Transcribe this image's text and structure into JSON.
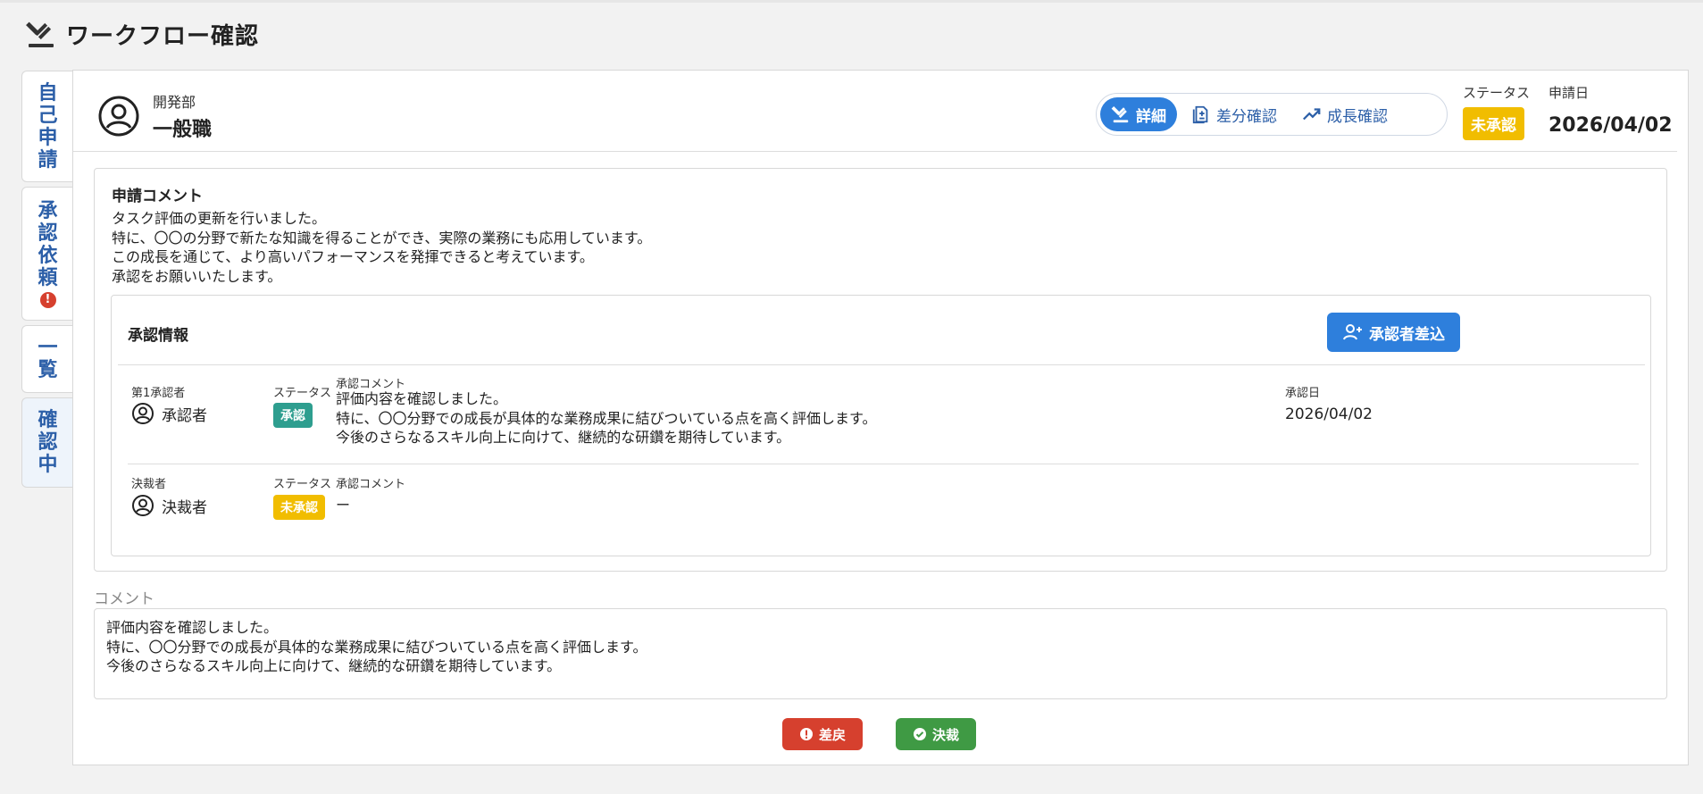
{
  "app": {
    "title": "ワークフロー確認"
  },
  "sidebar": {
    "tabs": [
      {
        "label": "自己申請",
        "chars": [
          "自",
          "己",
          "申",
          "請"
        ]
      },
      {
        "label": "承認依頼",
        "chars": [
          "承",
          "認",
          "依",
          "頼"
        ],
        "alert": "!"
      },
      {
        "label": "一覧",
        "chars": [
          "一",
          "覧"
        ]
      },
      {
        "label": "確認中",
        "chars": [
          "確",
          "認",
          "中"
        ],
        "active": true
      }
    ]
  },
  "profile": {
    "department": "開発部",
    "role": "一般職"
  },
  "view_tabs": [
    {
      "label": "詳細",
      "icon": "gavel-icon",
      "active": true
    },
    {
      "label": "差分確認",
      "icon": "document-diff-icon"
    },
    {
      "label": "成長確認",
      "icon": "trending-up-icon"
    }
  ],
  "status": {
    "label": "ステータス",
    "value": "未承認"
  },
  "application_date": {
    "label": "申請日",
    "value": "2026/04/02"
  },
  "application_comment": {
    "heading": "申請コメント",
    "lines": [
      "タスク評価の更新を行いました。",
      "特に、〇〇の分野で新たな知識を得ることができ、実際の業務にも応用しています。",
      "この成長を通じて、より高いパフォーマンスを発揮できると考えています。",
      "承認をお願いいたします。"
    ]
  },
  "approval_info": {
    "heading": "承認情報",
    "add_approver_label": "承認者差込",
    "rows": [
      {
        "role_label": "第1承認者",
        "name": "承認者",
        "status_label": "ステータス",
        "status": "承認",
        "comment_label": "承認コメント",
        "comment_lines": [
          "評価内容を確認しました。",
          "特に、〇〇分野での成長が具体的な業務成果に結びついている点を高く評価します。",
          "今後のさらなるスキル向上に向けて、継続的な研鑽を期待しています。"
        ],
        "date_label": "承認日",
        "date": "2026/04/02"
      },
      {
        "role_label": "決裁者",
        "name": "決裁者",
        "status_label": "ステータス",
        "status": "未承認",
        "comment_label": "承認コメント",
        "comment_lines": [
          "ー"
        ]
      }
    ]
  },
  "comment_field": {
    "label": "コメント",
    "lines": [
      "評価内容を確認しました。",
      "特に、〇〇分野での成長が具体的な業務成果に結びついている点を高く評価します。",
      "今後のさらなるスキル向上に向けて、継続的な研鑽を期待しています。"
    ]
  },
  "actions": {
    "reject_label": "差戻",
    "approve_label": "決裁"
  },
  "colors": {
    "primary": "#2e7fdc",
    "pending": "#f1bd00",
    "approved": "#2e9e8f",
    "reject": "#d6402e",
    "approve": "#3f9a44",
    "sidebar_text": "#2c5fa8"
  }
}
